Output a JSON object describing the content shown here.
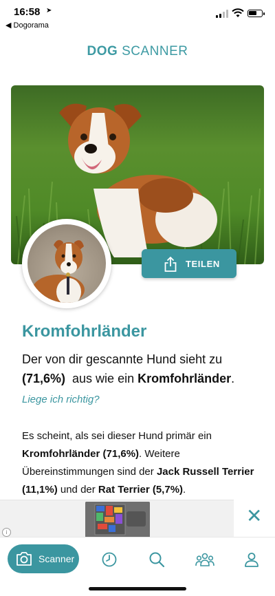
{
  "status_bar": {
    "time": "16:58",
    "back_app": "◀ Dogorama",
    "battery_level": 0.7
  },
  "header": {
    "title_bold": "DOG",
    "title_regular": " SCANNER",
    "accent_color": "#3b96a0"
  },
  "result": {
    "share_label": "TEILEN",
    "breed_name": "Kromfohrländer",
    "summary_part1": "Der von dir gescannte Hund sieht zu",
    "summary_pct": "(71,6%)",
    "summary_part2": "  aus wie ein ",
    "summary_breed": "Kromfohrländer",
    "summary_end": ".",
    "verify_link": "Liege ich richtig?",
    "detail_part1": "Es scheint, als sei dieser Hund primär ein ",
    "detail_primary": "Kromfohrländer (71,6%)",
    "detail_part2": ". Weitere Übereinstimmungen sind der ",
    "detail_second": "Jack Russell Terrier (11,1%)",
    "detail_part3": " und der ",
    "detail_third": "Rat Terrier (5,7%)",
    "detail_end": "."
  },
  "ad": {
    "info_glyph": "i",
    "close_glyph": "✕"
  },
  "tabbar": {
    "scanner_label": "Scanner",
    "icons": [
      "camera-icon",
      "clock-icon",
      "search-icon",
      "community-icon",
      "profile-icon"
    ]
  }
}
